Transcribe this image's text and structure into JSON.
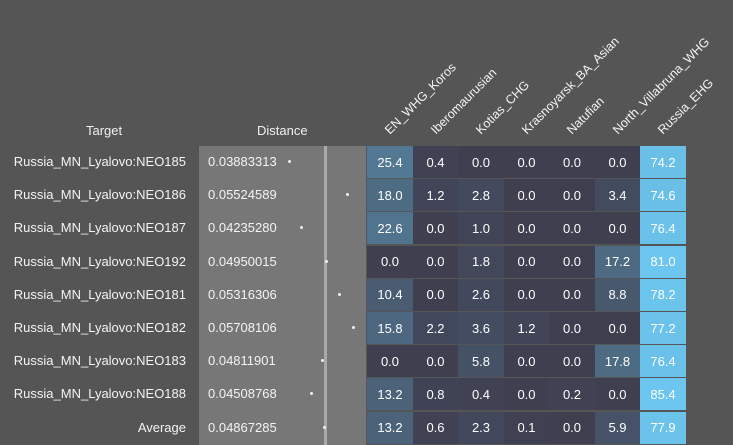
{
  "headers": {
    "target": "Target",
    "distance": "Distance"
  },
  "columns": [
    "EN_WHG_Koros",
    "Iberomaurusian",
    "Kotias_CHG",
    "Krasnoyarsk_BA_Asian",
    "Natufian",
    "North_Villabruna_WHG",
    "Russia_EHG"
  ],
  "rows": [
    {
      "label": "Russia_MN_Lyalovo:NEO185",
      "distance": "0.03883313",
      "dist_value": 0.03883313,
      "values": [
        "25.4",
        "0.4",
        "0.0",
        "0.0",
        "0.0",
        "0.0",
        "74.2"
      ]
    },
    {
      "label": "Russia_MN_Lyalovo:NEO186",
      "distance": "0.05524589",
      "dist_value": 0.05524589,
      "values": [
        "18.0",
        "1.2",
        "2.8",
        "0.0",
        "0.0",
        "3.4",
        "74.6"
      ]
    },
    {
      "label": "Russia_MN_Lyalovo:NEO187",
      "distance": "0.04235280",
      "dist_value": 0.0423528,
      "values": [
        "22.6",
        "0.0",
        "1.0",
        "0.0",
        "0.0",
        "0.0",
        "76.4"
      ]
    },
    {
      "label": "Russia_MN_Lyalovo:NEO192",
      "distance": "0.04950015",
      "dist_value": 0.04950015,
      "values": [
        "0.0",
        "0.0",
        "1.8",
        "0.0",
        "0.0",
        "17.2",
        "81.0"
      ]
    },
    {
      "label": "Russia_MN_Lyalovo:NEO181",
      "distance": "0.05316306",
      "dist_value": 0.05316306,
      "values": [
        "10.4",
        "0.0",
        "2.6",
        "0.0",
        "0.0",
        "8.8",
        "78.2"
      ]
    },
    {
      "label": "Russia_MN_Lyalovo:NEO182",
      "distance": "0.05708106",
      "dist_value": 0.05708106,
      "values": [
        "15.8",
        "2.2",
        "3.6",
        "1.2",
        "0.0",
        "0.0",
        "77.2"
      ]
    },
    {
      "label": "Russia_MN_Lyalovo:NEO183",
      "distance": "0.04811901",
      "dist_value": 0.04811901,
      "values": [
        "0.0",
        "0.0",
        "5.8",
        "0.0",
        "0.0",
        "17.8",
        "76.4"
      ]
    },
    {
      "label": "Russia_MN_Lyalovo:NEO188",
      "distance": "0.04508768",
      "dist_value": 0.04508768,
      "values": [
        "13.2",
        "0.8",
        "0.4",
        "0.0",
        "0.2",
        "0.0",
        "85.4"
      ]
    },
    {
      "label": "Average",
      "distance": "0.04867285",
      "dist_value": 0.04867285,
      "values": [
        "13.2",
        "0.6",
        "2.3",
        "0.1",
        "0.0",
        "5.9",
        "77.9"
      ]
    }
  ],
  "colors": {
    "background": "#555555",
    "distance_panel": "#777777",
    "distance_marker_line": "#a9a9a9",
    "cell_low": "#3f3f50",
    "cell_high": "#6cc6ef"
  }
}
